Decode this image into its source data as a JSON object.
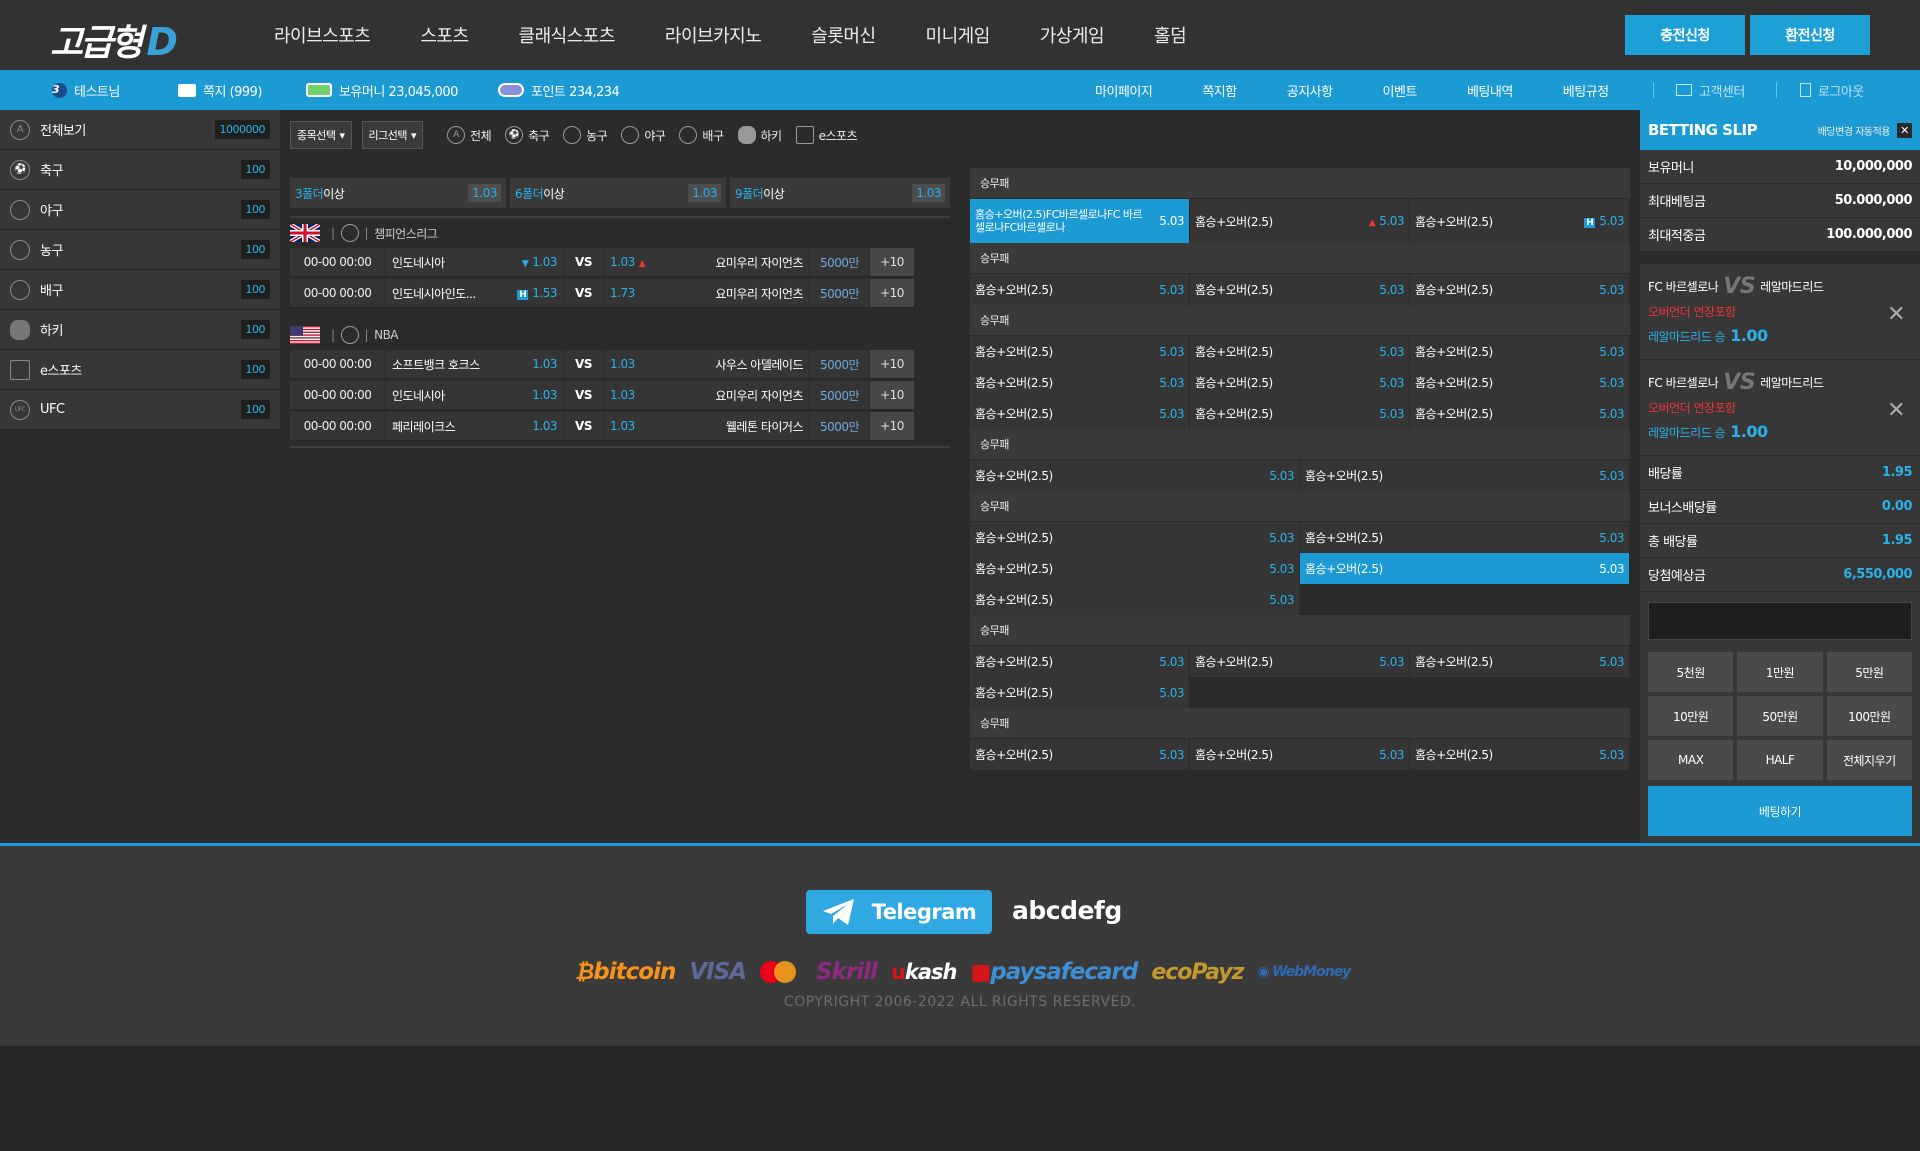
{
  "brand": {
    "name": "고급형",
    "letter": "D"
  },
  "nav": [
    "라이브스포츠",
    "스포츠",
    "클래식스포츠",
    "라이브카지노",
    "슬롯머신",
    "미니게임",
    "가상게임",
    "홀덤"
  ],
  "header_buttons": {
    "deposit": "충전신청",
    "withdraw": "환전신청"
  },
  "userbar": {
    "level": "3",
    "username": "테스트님",
    "messages": "쪽지 (999)",
    "money": "보유머니 23,045,000",
    "points": "포인트 234,234"
  },
  "topmenu": [
    "마이페이지",
    "쪽지함",
    "공지사항",
    "이벤트",
    "베팅내역",
    "베팅규정"
  ],
  "support": "고객센터",
  "logout": "로그아웃",
  "sidebar": [
    {
      "label": "전체보기",
      "count": "1000000",
      "icon": "all-icon"
    },
    {
      "label": "축구",
      "count": "100",
      "icon": "soccer-icon"
    },
    {
      "label": "야구",
      "count": "100",
      "icon": "baseball-icon"
    },
    {
      "label": "농구",
      "count": "100",
      "icon": "basketball-icon"
    },
    {
      "label": "배구",
      "count": "100",
      "icon": "volleyball-icon"
    },
    {
      "label": "하키",
      "count": "100",
      "icon": "hockey-icon"
    },
    {
      "label": "e스포츠",
      "count": "100",
      "icon": "esports-icon"
    },
    {
      "label": "UFC",
      "count": "100",
      "icon": "ufc-icon"
    }
  ],
  "filters": {
    "sport_select": "종목선택",
    "league_select": "리그선택",
    "sports": [
      "전체",
      "축구",
      "농구",
      "야구",
      "배구",
      "하키",
      "e스포츠"
    ]
  },
  "folders": [
    {
      "num": "3",
      "unit": "폴더",
      "suffix": "이상",
      "odd": "1.03"
    },
    {
      "num": "6",
      "unit": "폴더",
      "suffix": "이상",
      "odd": "1.03"
    },
    {
      "num": "9",
      "unit": "폴더",
      "suffix": "이상",
      "odd": "1.03"
    }
  ],
  "leagues": [
    {
      "name": "챔피언스리그",
      "flag": "uk",
      "matches": [
        {
          "time": "00-00 00:00",
          "home": "인도네시아",
          "home_odd": "1.03",
          "away_odd": "1.03",
          "away": "요미우리 자이언츠",
          "bet": "5000만",
          "more": "+10",
          "vs": "VS"
        },
        {
          "time": "00-00 00:00",
          "home": "인도네시아인도...",
          "home_odd": "1.53",
          "away_odd": "1.73",
          "away": "요미우리 자이언츠",
          "bet": "5000만",
          "more": "+10",
          "vs": "VS"
        }
      ]
    },
    {
      "name": "NBA",
      "flag": "us",
      "matches": [
        {
          "time": "00-00 00:00",
          "home": "소프트뱅크 호크스",
          "home_odd": "1.03",
          "away_odd": "1.03",
          "away": "사우스 아델레이드",
          "bet": "5000만",
          "more": "+10",
          "vs": "VS"
        },
        {
          "time": "00-00 00:00",
          "home": "인도네시아",
          "home_odd": "1.03",
          "away_odd": "1.03",
          "away": "요미우리 자이언츠",
          "bet": "5000만",
          "more": "+10",
          "vs": "VS"
        },
        {
          "time": "00-00 00:00",
          "home": "페리레이크스",
          "home_odd": "1.03",
          "away_odd": "1.03",
          "away": "웰레톤 타이거스",
          "bet": "5000만",
          "more": "+10",
          "vs": "VS"
        }
      ]
    }
  ],
  "markets": {
    "head": "승무패",
    "long_label": "홈승+오버(2.5)FC바르셀로나FC 바르셀로나FC바르셀로나",
    "label": "홈승+오버(2.5)",
    "odd": "5.03",
    "h": "H"
  },
  "slip": {
    "title": "BETTING SLIP",
    "auto": "배당변경 자동적용",
    "rows": [
      {
        "k": "보유머니",
        "v": "10,000,000"
      },
      {
        "k": "최대베팅금",
        "v": "50.000,000"
      },
      {
        "k": "최대적중금",
        "v": "100.000,000"
      }
    ],
    "bets": [
      {
        "home": "FC 바르셀로나",
        "away": "레알마드리드",
        "market": "오버언더 연장포함",
        "pick": "레알마드리드 승",
        "odd": "1.00"
      },
      {
        "home": "FC 바르셀로나",
        "away": "레알마드리드",
        "market": "오버언더 연장포함",
        "pick": "레알마드리드 승",
        "odd": "1.00"
      }
    ],
    "summary": [
      {
        "k": "배당률",
        "v": "1.95"
      },
      {
        "k": "보너스배당률",
        "v": "0.00"
      },
      {
        "k": "총 배당률",
        "v": "1.95"
      },
      {
        "k": "당첨예상금",
        "v": "6,550,000"
      }
    ],
    "amounts": [
      "5천원",
      "1만원",
      "5만원",
      "10만원",
      "50만원",
      "100만원",
      "MAX",
      "HALF",
      "전체지우기"
    ],
    "submit": "베팅하기"
  },
  "footer": {
    "telegram": "Telegram",
    "telegram_id": "abcdefg",
    "payments": [
      "bitcoin",
      "VISA",
      "Skrill",
      "ukash",
      "paysafecard",
      "ecoPayz",
      "WebMoney"
    ],
    "copyright": "COPYRIGHT  2006-2022  ALL RIGHTS RESERVED."
  },
  "colors": {
    "accent": "#1b9ad3",
    "odds": "#29b2e8",
    "alert": "#e33333"
  }
}
